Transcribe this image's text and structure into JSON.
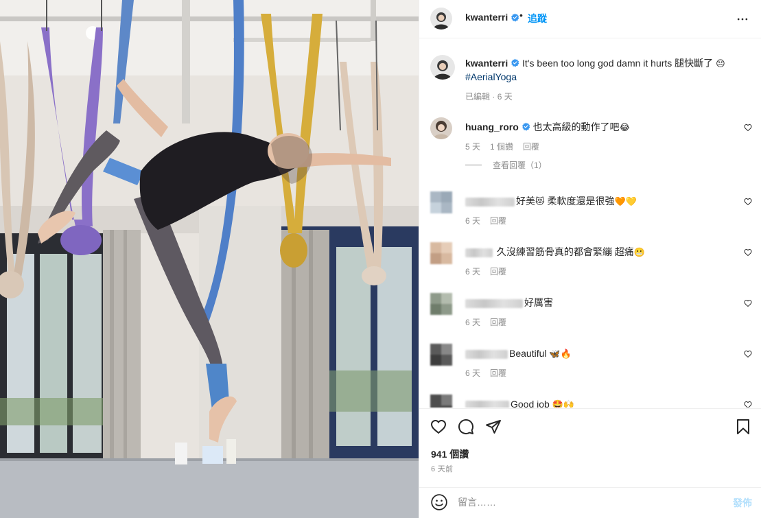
{
  "header": {
    "username": "kwanterri",
    "separator": "•",
    "follow_label": "追蹤"
  },
  "caption": {
    "username": "kwanterri",
    "text": "It's been too long god damn it hurts 腿快斷了",
    "emoji": "😣",
    "hashtag": "#AerialYoga",
    "edited": "已編輯",
    "time": "6 天"
  },
  "comments": [
    {
      "username": "huang_roro",
      "text": "也太高級的動作了吧",
      "emoji": "😂",
      "time": "5 天",
      "likes": "1 個讚",
      "reply_label": "回覆",
      "view_replies": "查看回覆（1）"
    },
    {
      "text": "好美",
      "emoji": "😻",
      "text2": "柔軟度還是很強",
      "emoji2": "🧡💛",
      "time": "6 天",
      "reply_label": "回覆"
    },
    {
      "text": "久沒練習筋骨真的都會緊繃 超痛",
      "emoji": "😬",
      "time": "6 天",
      "reply_label": "回覆"
    },
    {
      "text": "好厲害",
      "time": "6 天",
      "reply_label": "回覆"
    },
    {
      "text": "Beautiful",
      "emoji": "🦋🔥",
      "time": "6 天",
      "reply_label": "回覆"
    },
    {
      "text": "Good job",
      "emoji": "🤩🙌"
    }
  ],
  "actions": {
    "likes_count": "941 個讚",
    "date": "6 天前"
  },
  "add_comment": {
    "placeholder": "留言……",
    "post_label": "發佈"
  },
  "icons": {
    "verified": "verified-badge-icon",
    "more": "more-options-icon",
    "like": "heart-icon",
    "comment": "comment-icon",
    "share": "share-icon",
    "save": "bookmark-icon",
    "emoji": "emoji-icon"
  },
  "colors": {
    "accent": "#0095f6",
    "verified": "#3897f0",
    "hashtag": "#00376b",
    "muted": "#8e8e8e"
  }
}
